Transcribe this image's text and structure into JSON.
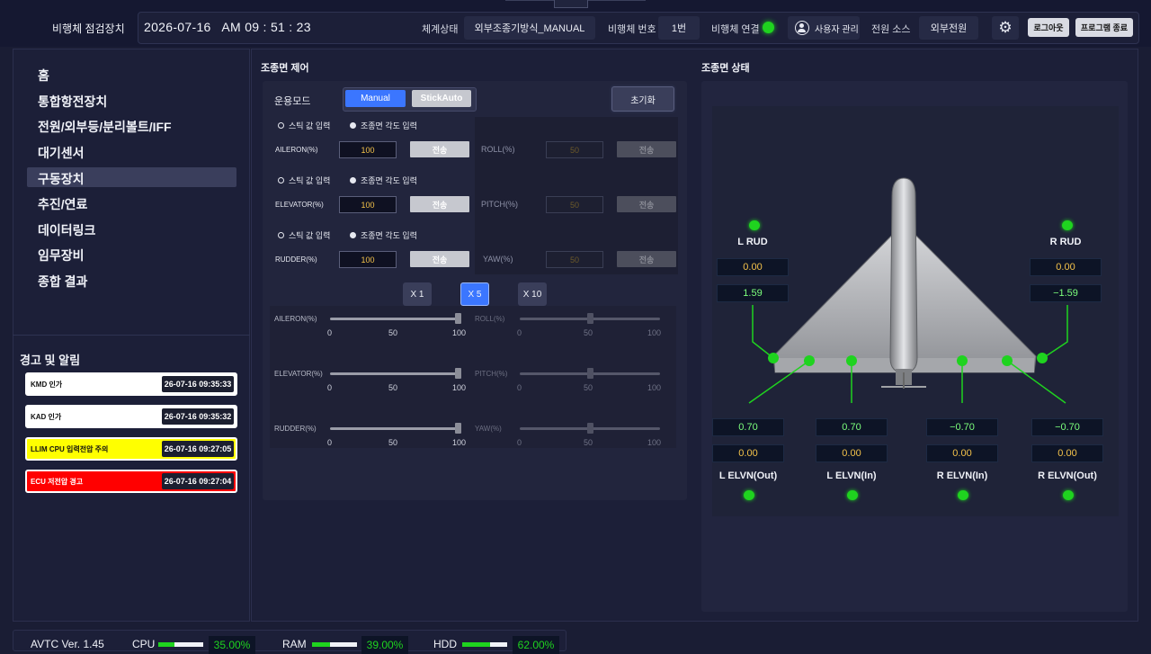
{
  "app": {
    "title": "비행체 점검장치"
  },
  "header": {
    "datetime": "2026-07-16   AM 09 : 51 : 23",
    "system_state_label": "체계상태",
    "system_state_value": "외부조종기방식_MANUAL",
    "vehicle_no_label": "비행체 번호",
    "vehicle_no_value": "1번",
    "connection_label": "비행체 연결",
    "user_mgmt_label": "사용자 관리",
    "power_source_label": "전원 소스",
    "power_source_value": "외부전원",
    "logout_label": "로그아웃",
    "exit_label": "프로그램 종료"
  },
  "sidebar": {
    "items": [
      {
        "label": "홈"
      },
      {
        "label": "통합항전장치"
      },
      {
        "label": "전원/외부등/분리볼트/IFF"
      },
      {
        "label": "대기센서"
      },
      {
        "label": "구동장치"
      },
      {
        "label": "추진/연료"
      },
      {
        "label": "데이터링크"
      },
      {
        "label": "임무장비"
      },
      {
        "label": "종합 결과"
      }
    ],
    "active_index": 4
  },
  "alerts": {
    "title": "경고 및 알림",
    "items": [
      {
        "text": "KMD 인가",
        "time": "26-07-16 09:35:33",
        "level": "info"
      },
      {
        "text": "KAD 인가",
        "time": "26-07-16 09:35:32",
        "level": "info"
      },
      {
        "text": "LLIM CPU 입력전압 주의",
        "time": "26-07-16 09:27:05",
        "level": "warning"
      },
      {
        "text": "ECU 저전압 경고",
        "time": "26-07-16 09:27:04",
        "level": "error"
      }
    ]
  },
  "control": {
    "title": "조종면 제어",
    "mode_label": "운용모드",
    "modes": [
      "Manual",
      "StickAuto"
    ],
    "active_mode": "Manual",
    "reset_label": "초기화",
    "radio_stick": "스틱 값 입력",
    "radio_angle": "조종면 각도 입력",
    "send_label": "전송",
    "rows": [
      {
        "left_label": "AILERON(%)",
        "left_value": "100",
        "right_label": "ROLL(%)",
        "right_value": "50"
      },
      {
        "left_label": "ELEVATOR(%)",
        "left_value": "100",
        "right_label": "PITCH(%)",
        "right_value": "50"
      },
      {
        "left_label": "RUDDER(%)",
        "left_value": "100",
        "right_label": "YAW(%)",
        "right_value": "50"
      }
    ],
    "multipliers": [
      "X 1",
      "X 5",
      "X 10"
    ],
    "active_multiplier": "X 5",
    "sliders": [
      {
        "left_label": "AILERON(%)",
        "left_value": 100,
        "right_label": "ROLL(%)",
        "right_value": 50
      },
      {
        "left_label": "ELEVATOR(%)",
        "left_value": 100,
        "right_label": "PITCH(%)",
        "right_value": 50
      },
      {
        "left_label": "RUDDER(%)",
        "left_value": 100,
        "right_label": "YAW(%)",
        "right_value": 50
      }
    ],
    "slider_ticks": [
      "0",
      "50",
      "100"
    ]
  },
  "status": {
    "title": "조종면 상태",
    "l_rud": {
      "label": "L RUD",
      "cmd": "0.00",
      "fb": "1.59"
    },
    "r_rud": {
      "label": "R RUD",
      "cmd": "0.00",
      "fb": "−1.59"
    },
    "l_elvn_out": {
      "label": "L ELVN(Out)",
      "fb": "0.70",
      "cmd": "0.00"
    },
    "l_elvn_in": {
      "label": "L ELVN(In)",
      "fb": "0.70",
      "cmd": "0.00"
    },
    "r_elvn_in": {
      "label": "R ELVN(In)",
      "fb": "−0.70",
      "cmd": "0.00"
    },
    "r_elvn_out": {
      "label": "R ELVN(Out)",
      "fb": "−0.70",
      "cmd": "0.00"
    }
  },
  "footer": {
    "version": "AVTC Ver.  1.45",
    "cpu_label": "CPU",
    "cpu_value": "35.00%",
    "cpu_pct": 35,
    "ram_label": "RAM",
    "ram_value": "39.00%",
    "ram_pct": 39,
    "hdd_label": "HDD",
    "hdd_value": "62.00%",
    "hdd_pct": 62
  },
  "colors": {
    "accent": "#3b76ff",
    "ok_green": "#1fd31f",
    "value_yellow": "#f3c24a",
    "alert_warning": "#ffff00",
    "alert_error": "#ff0000"
  }
}
